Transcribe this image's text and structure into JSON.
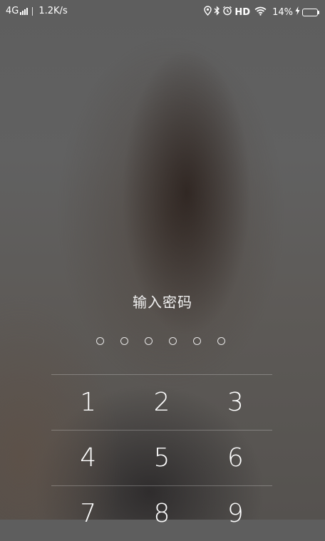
{
  "status_bar": {
    "network": "4G",
    "speed": "1.2K/s",
    "hd": "HD",
    "battery_percent": "14%",
    "battery_level": 0.14
  },
  "lock": {
    "title": "输入密码",
    "pin_length": 6
  },
  "keypad": {
    "rows": [
      [
        "1",
        "2",
        "3"
      ],
      [
        "4",
        "5",
        "6"
      ],
      [
        "7",
        "8",
        "9"
      ]
    ]
  }
}
